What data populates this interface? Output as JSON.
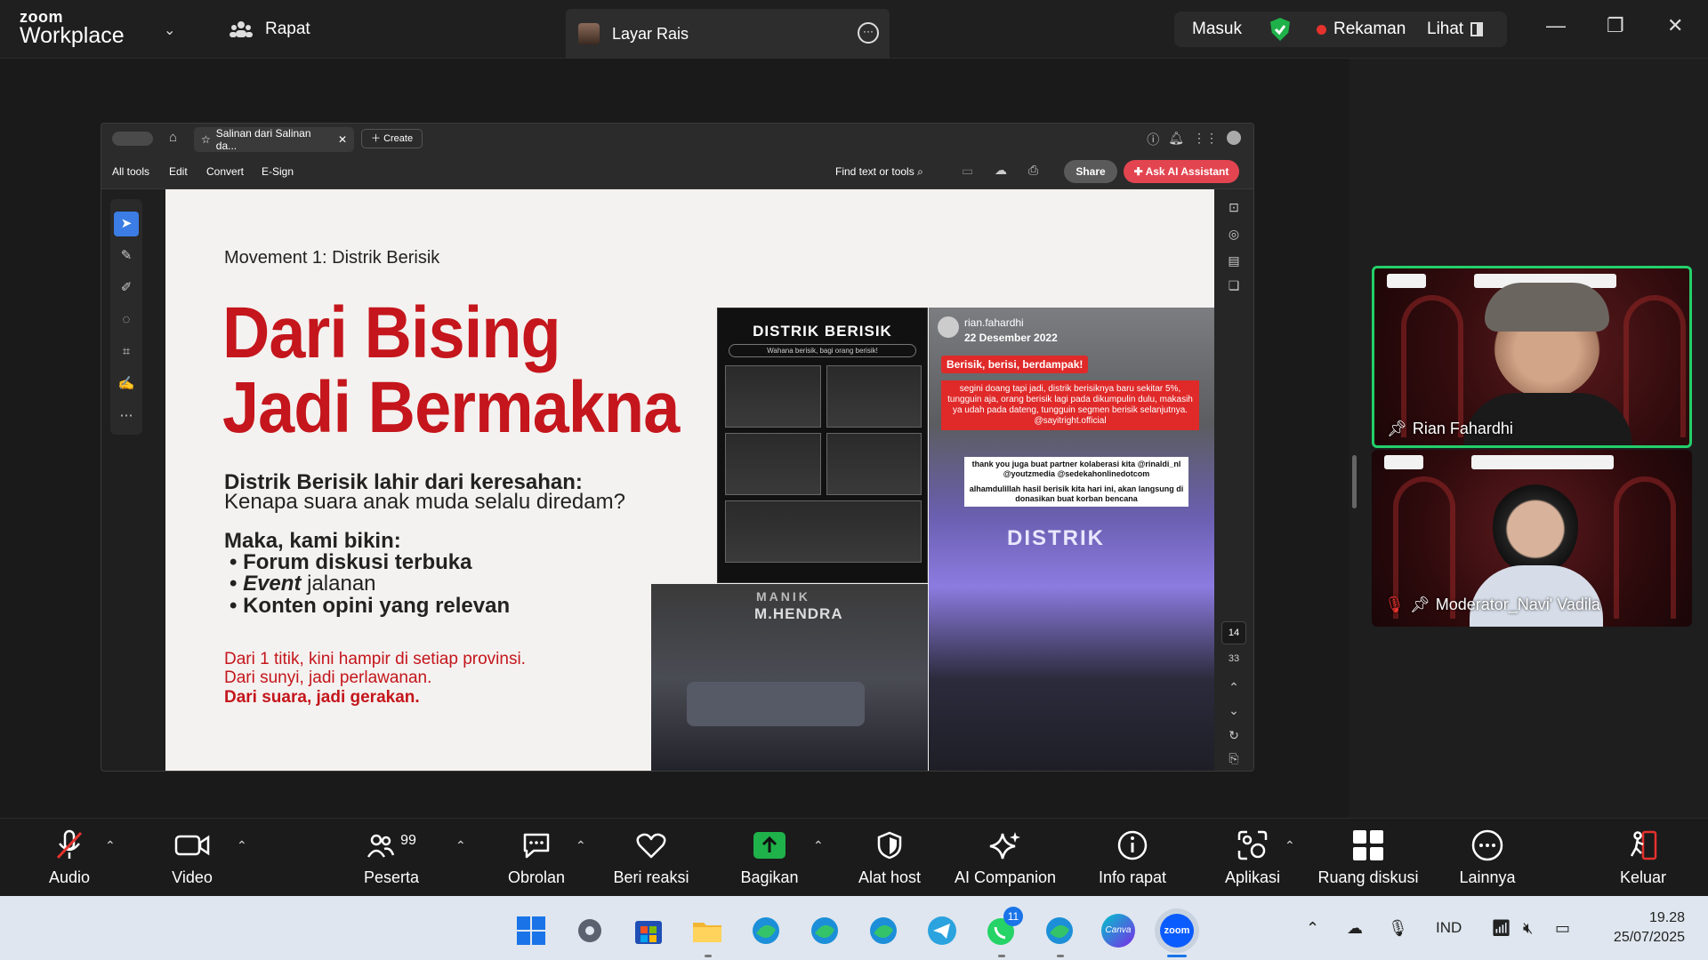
{
  "topbar": {
    "logo_top": "zoom",
    "logo_bottom": "Workplace",
    "meeting_label": "Rapat",
    "share_tab_label": "Layar Rais",
    "signin_label": "Masuk",
    "recording_label": "Rekaman",
    "view_label": "Lihat"
  },
  "acrobat": {
    "doc_tab": "Salinan dari Salinan da...",
    "create_label": "Create",
    "menu": [
      "All tools",
      "Edit",
      "Convert",
      "E-Sign"
    ],
    "find_label": "Find text or tools",
    "share_label": "Share",
    "ai_label": "Ask AI Assistant",
    "page_current": "14",
    "page_total": "33"
  },
  "slide": {
    "movement": "Movement 1: Distrik Berisik",
    "title_line1": "Dari Bising",
    "title_line2": "Jadi Bermakna",
    "intro_bold": "Distrik Berisik lahir dari keresahan:",
    "intro_rest": "Kenapa suara anak muda selalu diredam?",
    "maka": "Maka, kami bikin:",
    "bullets": [
      "Forum diskusi terbuka",
      "Event",
      " jalanan",
      "Konten opini yang relevan"
    ],
    "red1": "Dari 1 titik, kini hampir di setiap provinsi.",
    "red2": "Dari sunyi, jadi perlawanan.",
    "red3": "Dari suara, jadi gerakan.",
    "poster_title": "DISTRIK BERISIK",
    "poster_sub": "Wahana berisik, bagi orang berisik!",
    "post_user": "rian.fahardhi",
    "post_date": "22 Desember 2022",
    "post_head": "Berisik, berisi, berdampak!",
    "post_para": "segini doang tapi jadi, distrik berisiknya baru sekitar 5%, tungguin aja, orang berisik lagi pada dikumpulin dulu, makasih ya udah pada dateng, tungguin segmen berisik selanjutnya. @sayitright.official",
    "post_thanks": "thank you juga buat partner kolaberasi kita @rinaldi_nl @youtzmedia @sedekahonlinedotcom",
    "post_alham": "alhamdulillah hasil berisik kita hari ini, akan langsung di donasikan buat korban bencana",
    "stage_text": "DISTRIK",
    "photo_caption1": "MANIK",
    "photo_caption2": "M.HENDRA"
  },
  "participants": [
    {
      "name": "Rian Fahardhi"
    },
    {
      "name": "Moderator_Navi' Vadila"
    }
  ],
  "toolbar": {
    "audio": "Audio",
    "video": "Video",
    "participants": "Peserta",
    "participants_count": "99",
    "chat": "Obrolan",
    "react": "Beri reaksi",
    "share": "Bagikan",
    "host_tools": "Alat host",
    "ai_companion": "AI Companion",
    "meeting_info": "Info rapat",
    "apps": "Aplikasi",
    "breakout": "Ruang diskusi",
    "more": "Lainnya",
    "leave": "Keluar"
  },
  "taskbar": {
    "whatsapp_badge": "11",
    "lang": "IND",
    "time": "19.28",
    "date": "25/07/2025",
    "canva": "Canva",
    "zoom": "zoom"
  },
  "colors": {
    "accent_red": "#c4161c",
    "active_green": "#23d06a",
    "share_green": "#1fb14a",
    "ai_red": "#e34550"
  }
}
